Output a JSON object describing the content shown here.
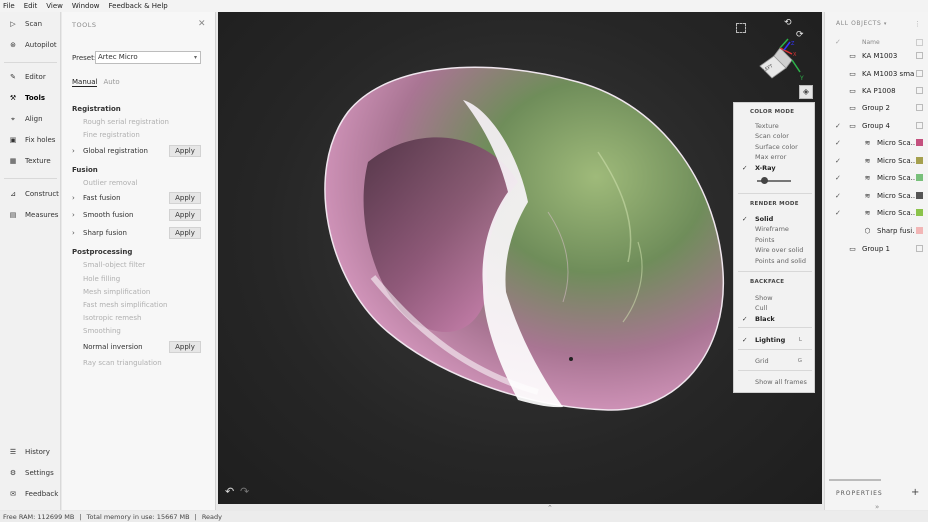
{
  "menubar": [
    "File",
    "Edit",
    "View",
    "Window",
    "Feedback & Help"
  ],
  "nav": [
    {
      "name": "scan",
      "label": "Scan",
      "icon": "scan-icon"
    },
    {
      "name": "autopilot",
      "label": "Autopilot",
      "icon": "autopilot-icon"
    },
    {
      "name": "editor",
      "label": "Editor",
      "icon": "pen-icon"
    },
    {
      "name": "tools",
      "label": "Tools",
      "icon": "wand-icon",
      "active": true
    },
    {
      "name": "align",
      "label": "Align",
      "icon": "align-icon"
    },
    {
      "name": "fix-holes",
      "label": "Fix holes",
      "icon": "fix-holes-icon"
    },
    {
      "name": "texture",
      "label": "Texture",
      "icon": "texture-icon"
    },
    {
      "name": "construct",
      "label": "Construct",
      "icon": "construct-icon"
    },
    {
      "name": "measures",
      "label": "Measures",
      "icon": "ruler-icon"
    },
    {
      "name": "history",
      "label": "History",
      "icon": "history-icon"
    },
    {
      "name": "settings",
      "label": "Settings",
      "icon": "gear-icon"
    },
    {
      "name": "feedback",
      "label": "Feedback",
      "icon": "feedback-icon"
    }
  ],
  "tools": {
    "title": "TOOLS",
    "preset_label": "Preset:",
    "preset_value": "Artec Micro",
    "tab_manual": "Manual",
    "tab_auto": "Auto",
    "apply_label": "Apply",
    "sections": {
      "registration": "Registration",
      "fusion": "Fusion",
      "postprocessing": "Postprocessing"
    },
    "registration": [
      {
        "label": "Rough serial registration",
        "enabled": false
      },
      {
        "label": "Fine registration",
        "enabled": false
      },
      {
        "label": "Global registration",
        "enabled": true,
        "apply": true
      }
    ],
    "fusion": [
      {
        "label": "Outlier removal",
        "enabled": false
      },
      {
        "label": "Fast fusion",
        "enabled": true,
        "apply": true
      },
      {
        "label": "Smooth fusion",
        "enabled": true,
        "apply": true
      },
      {
        "label": "Sharp fusion",
        "enabled": true,
        "apply": true
      }
    ],
    "postprocessing": [
      {
        "label": "Small-object filter",
        "enabled": false
      },
      {
        "label": "Hole filling",
        "enabled": false
      },
      {
        "label": "Mesh simplification",
        "enabled": false
      },
      {
        "label": "Fast mesh simplification",
        "enabled": false
      },
      {
        "label": "Isotropic remesh",
        "enabled": false
      },
      {
        "label": "Smoothing",
        "enabled": false
      },
      {
        "label": "Normal inversion",
        "enabled": true,
        "apply": true
      },
      {
        "label": "Ray scan triangulation",
        "enabled": false
      }
    ]
  },
  "view_menu": {
    "color_mode_header": "COLOR MODE",
    "color_modes": [
      "Texture",
      "Scan color",
      "Surface color",
      "Max error",
      "X-Ray"
    ],
    "color_mode_selected": "X-Ray",
    "xray_opacity": 0.15,
    "render_mode_header": "RENDER MODE",
    "render_modes": [
      "Solid",
      "Wireframe",
      "Points",
      "Wire over solid",
      "Points and solid"
    ],
    "render_mode_selected": "Solid",
    "backface_header": "BACKFACE",
    "backface_modes": [
      "Show",
      "Cull",
      "Black"
    ],
    "backface_selected": "Black",
    "lighting_label": "Lighting",
    "lighting_key": "L",
    "grid_label": "Grid",
    "grid_key": "G",
    "show_all_frames": "Show all frames"
  },
  "gizmo": {
    "label": "LEFT",
    "axis_x": "X",
    "axis_y": "Y",
    "axis_z": "Z"
  },
  "objects": {
    "header": "ALL OBJECTS",
    "name_col": "Name",
    "items": [
      {
        "label": "KA M1003",
        "type": "folder",
        "level": 0,
        "checked": false
      },
      {
        "label": "KA M1003 small",
        "type": "folder",
        "level": 0,
        "checked": false
      },
      {
        "label": "KA P1008",
        "type": "folder",
        "level": 0,
        "checked": false
      },
      {
        "label": "Group 2",
        "type": "folder",
        "level": 0,
        "checked": false
      },
      {
        "label": "Group 4",
        "type": "folder",
        "level": 0,
        "checked": true
      },
      {
        "label": "Micro Sca...",
        "type": "scan",
        "level": 1,
        "checked": true,
        "color": "#c4507e"
      },
      {
        "label": "Micro Sca...",
        "type": "scan",
        "level": 1,
        "checked": true,
        "color": "#a5a04e"
      },
      {
        "label": "Micro Sca...",
        "type": "scan",
        "level": 1,
        "checked": true,
        "color": "#78c07a"
      },
      {
        "label": "Micro Sca...",
        "type": "scan",
        "level": 1,
        "checked": true,
        "color": "#555555"
      },
      {
        "label": "Micro Sca...",
        "type": "scan",
        "level": 1,
        "checked": true,
        "color": "#8bc34a"
      },
      {
        "label": "Sharp fusi...",
        "type": "model",
        "level": 1,
        "checked": false,
        "color": "#f2b6b6"
      },
      {
        "label": "Group 1",
        "type": "folder",
        "level": 0,
        "checked": false
      }
    ],
    "properties_label": "PROPERTIES"
  },
  "status": {
    "free_ram": "Free RAM: 112699 MB",
    "total_memory": "Total memory in use: 15667 MB",
    "state": "Ready"
  },
  "colors": {
    "accent": "#c4507e",
    "viewport_bg": "#262626"
  }
}
